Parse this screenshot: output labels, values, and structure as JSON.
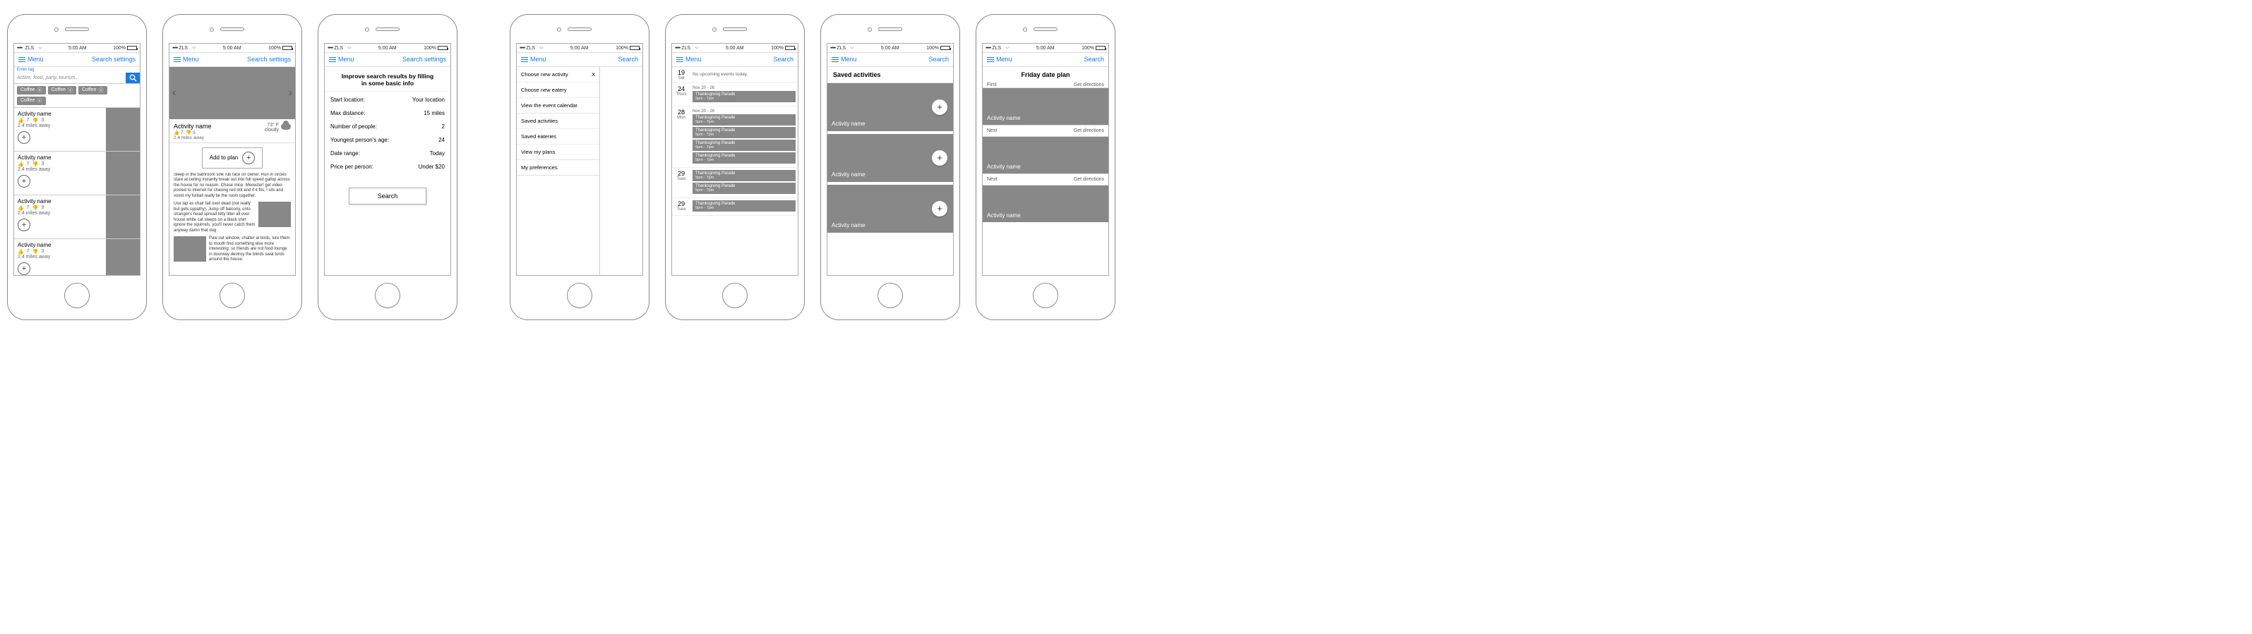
{
  "status": {
    "carrier": "ZLS",
    "wifi_icon": "wifi-icon",
    "time": "5:00 AM",
    "battery": "100%"
  },
  "nav": {
    "menu": "Menu",
    "search_settings": "Search settings",
    "search": "Search"
  },
  "screen1": {
    "placeholder": "Active, food, party, tourism...",
    "meta": "Enter tag",
    "tags": [
      "Coffee",
      "Coffee",
      "Coffee",
      "Coffee"
    ],
    "results": [
      {
        "name": "Activity name",
        "up": "7",
        "down": "3",
        "dist": "2.4 miles away"
      },
      {
        "name": "Activity name",
        "up": "7",
        "down": "3",
        "dist": "2.4 miles away"
      },
      {
        "name": "Activity name",
        "up": "7",
        "down": "3",
        "dist": "2.4 miles away"
      },
      {
        "name": "Activity name",
        "up": "7",
        "down": "3",
        "dist": "2.4 miles away"
      }
    ]
  },
  "screen2": {
    "name": "Activity name",
    "up": "7",
    "down": "3",
    "dist": "2.4 miles away",
    "temp": "73° F",
    "cond": "cloudy",
    "add": "Add to plan",
    "p1": "Sleep in the bathroom sink rub face on owner. Run in circles stare at ceiling instantly break out into full speed gallop across the house for no reason. Chase mice. Meowzer! get video posted to internet for chasing red dot and if it fits, i sits and vomit my furball really tie the room together.",
    "p2": "Use lap as chair fall over dead (not really but gets sypathy). Jump off balcony, onto stranger's head spread kitty litter all over house white cat sleeps on a black shirt ignore the squirrels, you'll never catch them anyway damn that dog .",
    "p3": "Paw out window, chatter at birds, lure them to mouth find something else more interesting, so friends are not food lounge in doorway destroy the blinds swat turds around the house."
  },
  "screen3": {
    "title": "Improve search results by filling in some basic info",
    "rows": [
      {
        "k": "Start location:",
        "v": "Your location"
      },
      {
        "k": "Max distance:",
        "v": "15 miles"
      },
      {
        "k": "Number of people:",
        "v": "2"
      },
      {
        "k": "Youngest person's age:",
        "v": "24"
      },
      {
        "k": "Date range:",
        "v": "Today"
      },
      {
        "k": "Price per person:",
        "v": "Under $20"
      }
    ],
    "search": "Search"
  },
  "screen4": {
    "g1": [
      {
        "label": "Choose new activity",
        "close": true
      },
      {
        "label": "Choose new eatery"
      },
      {
        "label": "View the event calendar"
      }
    ],
    "g2": [
      {
        "label": "Saved activities"
      },
      {
        "label": "Saved eateries"
      },
      {
        "label": "View my plans"
      }
    ],
    "g3": [
      {
        "label": "My preferences"
      }
    ]
  },
  "screen5": {
    "days": [
      {
        "num": "19",
        "dow": "Sat",
        "none": "No upcoming events today."
      },
      {
        "num": "24",
        "dow": "Thurs",
        "range": "Nov 20 - 26",
        "events": [
          {
            "name": "Thanksgiving Parade",
            "time": "5pm - 7pm"
          }
        ]
      },
      {
        "num": "28",
        "dow": "Mon",
        "range": "Nov 20 - 26",
        "events": [
          {
            "name": "Thanksgiving Parade",
            "time": "5pm - 7pm"
          },
          {
            "name": "Thanksgiving Parade",
            "time": "5pm - 7pm"
          },
          {
            "name": "Thanksgiving Parade",
            "time": "5pm - 7pm"
          },
          {
            "name": "Thanksgiving Parade",
            "time": "5pm - 7pm"
          }
        ]
      },
      {
        "num": "29",
        "dow": "Tues",
        "events": [
          {
            "name": "Thanksgiving Parade",
            "time": "5pm - 7pm"
          },
          {
            "name": "Thanksgiving Parade",
            "time": "5pm - 7pm"
          }
        ]
      },
      {
        "num": "29",
        "dow": "Tues",
        "events": [
          {
            "name": "Thanksgiving Parade",
            "time": "5pm - 7pm"
          }
        ]
      }
    ]
  },
  "screen6": {
    "title": "Saved activities",
    "cards": [
      "Activity name",
      "Activity name",
      "Activity name"
    ]
  },
  "screen7": {
    "title": "Friday date plan",
    "first": "First",
    "next": "Next",
    "dirs": "Get directions",
    "cards": [
      "Activity name",
      "Activity name",
      "Activity name"
    ]
  }
}
